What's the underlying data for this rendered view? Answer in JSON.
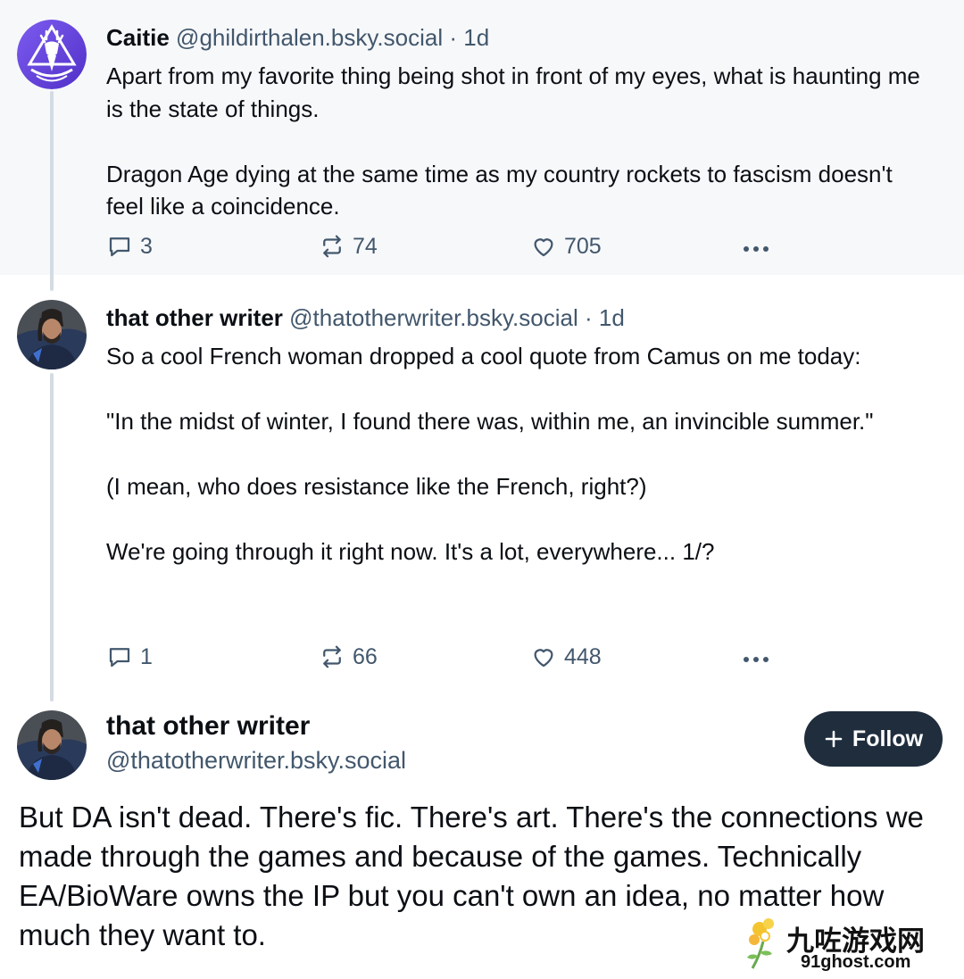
{
  "thread": [
    {
      "author": "Caitie",
      "handle": "@ghildirthalen.bsky.social",
      "separator": "·",
      "age": "1d",
      "paragraphs": [
        "Apart from my favorite thing being shot in front of my eyes, what is haunting me is the state of things.",
        "Dragon Age dying at the same time as my country rockets to fascism doesn't feel like a coincidence."
      ],
      "replies": "3",
      "reposts": "74",
      "likes": "705"
    },
    {
      "author": "that other writer",
      "handle": "@thatotherwriter.bsky.social",
      "separator": "·",
      "age": "1d",
      "paragraphs": [
        "So a cool French woman dropped a cool quote from Camus on me today:",
        "\"In the midst of winter, I found there was, within me, an invincible summer.\"",
        "(I mean, who does resistance like the French, right?)",
        "We're going through it right now. It's a lot, everywhere... 1/?"
      ],
      "replies": "1",
      "reposts": "66",
      "likes": "448"
    }
  ],
  "main_post": {
    "author": "that other writer",
    "handle": "@thatotherwriter.bsky.social",
    "follow_label": "Follow",
    "text": "But DA isn't dead. There's fic. There's art. There's the connections we made through the games and because of the games. Technically EA/BioWare owns the IP but you can't own an idea, no matter how much they want to."
  },
  "icons": {
    "reply": "reply-icon",
    "repost": "repost-icon",
    "like": "heart-icon",
    "more": "more-options-icon",
    "follow": "plus-icon"
  },
  "watermark": {
    "site_name": "九咗游戏网",
    "url": "91ghost.com"
  },
  "colors": {
    "text_primary": "#0b0f14",
    "text_secondary": "#42576c",
    "follow_button_bg": "#1f2d3d",
    "thread_line": "#d4dbe2"
  }
}
